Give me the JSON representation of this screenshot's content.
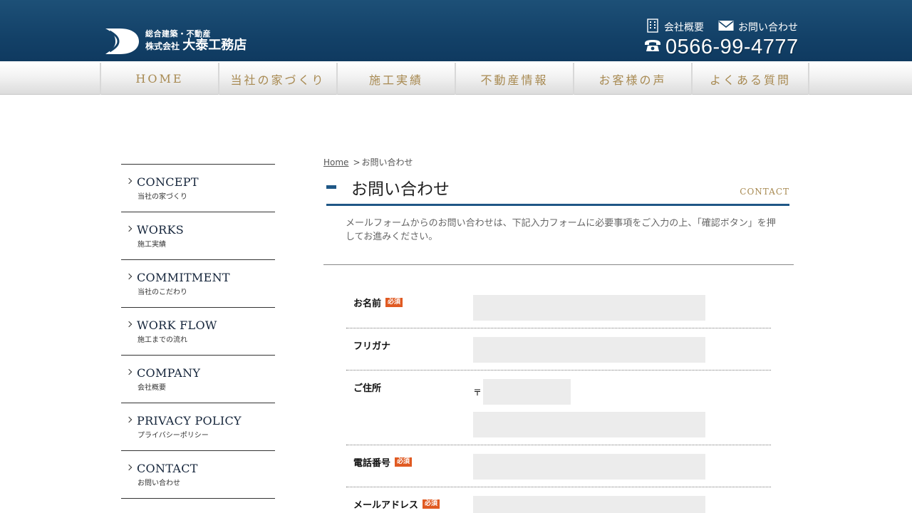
{
  "header": {
    "logo_sub": "総合建築・不動産",
    "logo_company_prefix": "株式会社",
    "logo_company_name": "大泰工務店",
    "links": [
      {
        "label": "会社概要",
        "icon": "building-icon"
      },
      {
        "label": "お問い合わせ",
        "icon": "mail-icon"
      }
    ],
    "phone": "0566-99-4777",
    "phone_icon": "phone-icon"
  },
  "nav": {
    "items": [
      "HOME",
      "当社の家づくり",
      "施工実績",
      "不動産情報",
      "お客様の声",
      "よくある質問"
    ]
  },
  "sidebar": {
    "items": [
      {
        "en": "CONCEPT",
        "jp": "当社の家づくり"
      },
      {
        "en": "WORKS",
        "jp": "施工実績"
      },
      {
        "en": "COMMITMENT",
        "jp": "当社のこだわり"
      },
      {
        "en": "WORK FLOW",
        "jp": "施工までの流れ"
      },
      {
        "en": "COMPANY",
        "jp": "会社概要"
      },
      {
        "en": "PRIVACY POLICY",
        "jp": "プライバシーポリシー"
      },
      {
        "en": "CONTACT",
        "jp": "お問い合わせ"
      }
    ]
  },
  "breadcrumb": {
    "home": "Home",
    "separator": ">",
    "current": "お問い合わせ"
  },
  "page": {
    "title": "お問い合わせ",
    "title_en": "CONTACT",
    "intro": "メールフォームからのお問い合わせは、下記入力フォームに必要事項をご入力の上、「確認ボタン」を押してお進みください。"
  },
  "form": {
    "required_label": "必須",
    "zip_mark": "〒",
    "fields": {
      "name": {
        "label": "お名前",
        "value": "",
        "required": true
      },
      "kana": {
        "label": "フリガナ",
        "value": "",
        "required": false
      },
      "address": {
        "label": "ご住所",
        "zip_value": "",
        "value": "",
        "required": false
      },
      "phone": {
        "label": "電話番号",
        "value": "",
        "required": true
      },
      "email": {
        "label": "メールアドレス",
        "value": "",
        "required": true
      }
    }
  },
  "colors": {
    "header_bg": "#134168",
    "accent_blue": "#1f5786",
    "gold": "#a88a52",
    "required_badge": "#e05a22",
    "field_bg": "#ececec"
  }
}
